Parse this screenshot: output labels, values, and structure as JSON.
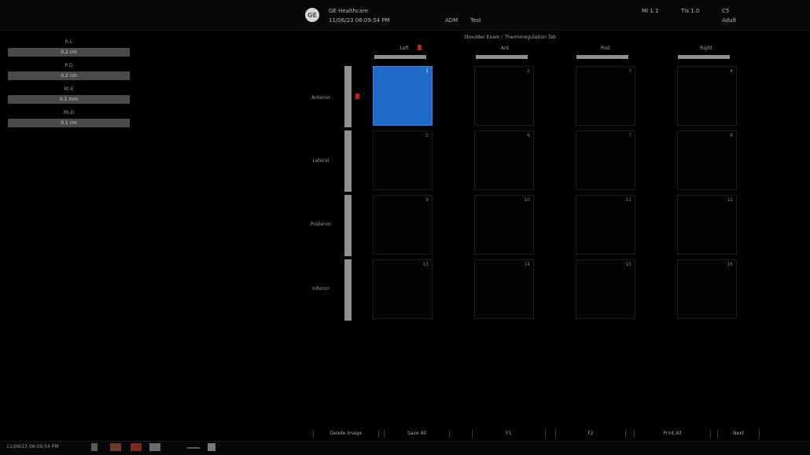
{
  "header": {
    "logo": "GE",
    "company": "GE Healthcare",
    "datetime": "11/06/23 06:09:54 PM",
    "probe_label": "ADM",
    "probe_value": "Test",
    "mi": "MI 1.1",
    "tis": "TIs 1.0",
    "mode": "C5",
    "adult": "Adult"
  },
  "left_panel": {
    "fields": [
      {
        "label": "R-L",
        "value": "0.2 cm"
      },
      {
        "label": "P-D",
        "value": "0.2 cm"
      },
      {
        "label": "Rt-E",
        "value": "0.1 mm"
      },
      {
        "label": "Rt-D",
        "value": "0.1 cm"
      }
    ]
  },
  "grid": {
    "title": "Shoulder Exam / Thermoregulation Tab",
    "columns": [
      "Left",
      "Ant",
      "Post",
      "Right"
    ],
    "rows": [
      "Anterior",
      "Lateral",
      "Posterior",
      "Inferior"
    ],
    "cells": [
      [
        "1",
        "2",
        "3",
        "4"
      ],
      [
        "5",
        "6",
        "7",
        "8"
      ],
      [
        "9",
        "10",
        "11",
        "12"
      ],
      [
        "13",
        "14",
        "15",
        "16"
      ]
    ],
    "selected": "1"
  },
  "buttons": [
    "Delete Image",
    "Save All",
    "F1",
    "F2",
    "Print All",
    "Next"
  ],
  "status": {
    "datetime": "11/06/23 06:09:54 PM",
    "colors": {
      "accent": "#1f69c7",
      "marker": "#c41f1f"
    }
  }
}
